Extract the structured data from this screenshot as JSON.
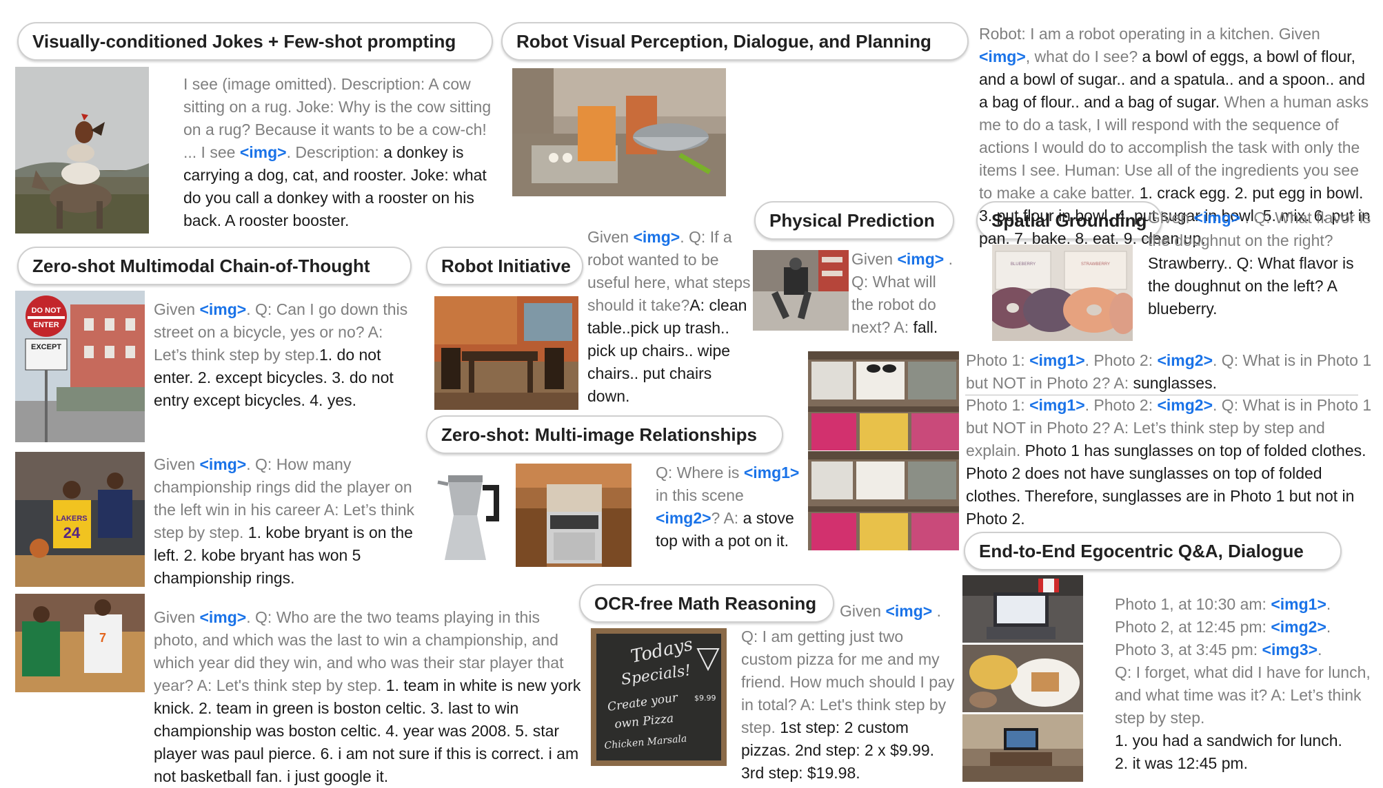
{
  "headers": {
    "jokes": "Visually-conditioned Jokes + Few-shot prompting",
    "robot_planning": "Robot Visual Perception, Dialogue, and Planning",
    "physical": "Physical Prediction",
    "spatial": "Spatial Grounding",
    "chain_of_thought": "Zero-shot Multimodal Chain-of-Thought",
    "robot_initiative": "Robot Initiative",
    "multi_image": "Zero-shot: Multi-image Relationships",
    "egocentric": "End-to-End Egocentric Q&A, Dialogue",
    "ocr_math": "OCR-free Math Reasoning"
  },
  "tokens": {
    "img": "<img>",
    "img1": "<img1>",
    "img2": "<img2>",
    "img3": "<img3>"
  },
  "jokes": {
    "p1": "I see (image omitted). Description: A cow sitting on a rug. Joke: Why is the cow sitting on a rug? Because it wants to be a cow-ch! ... I see ",
    "p2": ". Description: ",
    "answer": "a donkey is carrying a dog, cat, and rooster. Joke: what do you call a donkey with a rooster on his back. A rooster booster."
  },
  "robot_planning": {
    "p1": "Robot: I am a robot operating in a kitchen. Given ",
    "p2": ", what do I see? ",
    "a1": "a bowl of eggs, a bowl of flour, and a bowl of sugar.. and a spatula.. and a spoon.. and a bag of flour.. and a bag of sugar.",
    "p3": " When a human asks me to do a task, I will respond with the sequence of actions I would do to accomplish the task with only the items I see.  Human: Use all of the ingredients you see to make a cake batter. ",
    "a2": "1. crack egg. 2. put egg in bowl. 3. put flour in bowl. 4. put sugar in bowl. 5. mix. 6. put in pan. 7. bake. 8. eat. 9. clean up."
  },
  "physical": {
    "p1": "Given ",
    "p2": " . Q: What will the robot do next? A: ",
    "answer": "fall."
  },
  "spatial": {
    "p1": "Given ",
    "p2": " . Q: What flavor is the doughnut on the right? ",
    "a1": "Strawberry.. Q: What flavor is the doughnut on the left? A blueberry."
  },
  "cot_street": {
    "p1": "Given ",
    "p2": ". Q: Can I go down this street on a bicycle, yes or no? A: Let’s think step by step.",
    "answer": "1. do not enter. 2. except bicycles. 3. do not entry except bicycles. 4. yes."
  },
  "cot_kobe": {
    "p1": "Given ",
    "p2": ". Q: How many championship rings did the player on the left win in his career A: Let’s think step by step.",
    "answer": " 1. kobe bryant is on the left. 2. kobe bryant has won 5 championship rings."
  },
  "cot_teams": {
    "p1": "Given ",
    "p2": ". Q: Who are the two teams playing in this photo, and which was the last to win a championship, and which year did they win, and who was their star player that year? A: Let's think step by step.",
    "answer": " 1. team in white is new york knick. 2. team in green is boston celtic. 3. last to win championship was boston celtic. 4. year was 2008. 5. star player was paul pierce. 6. i am not sure if this is correct. i am not basketball fan. i just google it."
  },
  "robot_initiative": {
    "p1": "Given ",
    "p2": ". Q: If a robot wanted to be useful here, what steps should it take?",
    "answer": "A: clean table..pick up trash.. pick up chairs.. wipe chairs.. put chairs down."
  },
  "multi_image": {
    "p1": "Q: Where is ",
    "p2": " in this scene ",
    "p3": "? A: ",
    "answer": "a stove top with a pot on it."
  },
  "sunglasses1": {
    "p1": "Photo 1: ",
    "p2": ". Photo 2: ",
    "p3": ". Q: What is in Photo 1 but NOT in Photo 2? A: ",
    "answer": "sunglasses."
  },
  "sunglasses2": {
    "p1": "Photo 1: ",
    "p2": ". Photo 2: ",
    "p3": ". Q: What is in Photo 1 but NOT in Photo 2? A: Let’s think step by step and explain.",
    "answer": " Photo 1 has sunglasses on top of folded clothes. Photo 2 does not have sunglasses on top of folded clothes. Therefore, sunglasses are in Photo 1 but not in Photo 2."
  },
  "egocentric": {
    "l1": "Photo 1, at 10:30 am: ",
    "l2": "Photo 2, at 12:45 pm: ",
    "l3": "Photo 3, at 3:45 pm: ",
    "dot": ".",
    "q": "Q: I forget, what did I have for lunch, and what time was it? A: Let’s think step by step.",
    "a1": "1. you had a sandwich for lunch.",
    "a2": "2. it was 12:45 pm."
  },
  "ocr_math": {
    "p1": "Given ",
    "p2": " .",
    "q": "Q: I am getting just two custom pizza for me and my friend. How much should I pay in total? A: Let's think step by step.",
    "answer": " 1st step: 2 custom pizzas. 2nd step: 2 x $9.99. 3rd step: $19.98."
  },
  "chalkboard": {
    "l1": "Todays",
    "l2": "Specials!",
    "l3": "Create your",
    "l4": "own Pizza",
    "l5": "Chicken Marsala",
    "price": "$9.99"
  },
  "signs": {
    "stop1": "DO NOT",
    "stop2": "ENTER",
    "except": "EXCEPT"
  },
  "jerseys": {
    "team": "LAKERS",
    "number": "24"
  },
  "boxes": {
    "blue": "BLUEBERRY",
    "red": "STRAWBERRY"
  }
}
